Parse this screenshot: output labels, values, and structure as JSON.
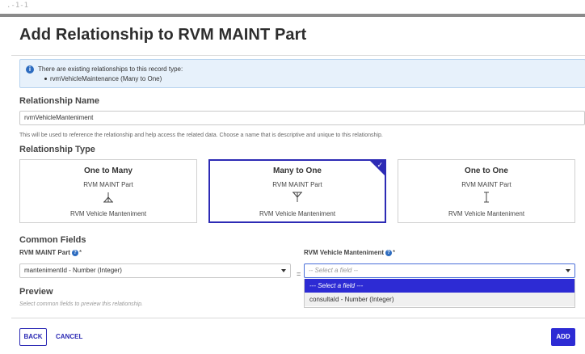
{
  "dialog": {
    "title": "Add Relationship to RVM MAINT Part"
  },
  "info": {
    "icon": "info-icon",
    "line1": "There are existing relationships to this record type:",
    "line2": "rvmVehicleMaintenance (Many to One)"
  },
  "relationship_name": {
    "label": "Relationship Name",
    "value": "rvmVehicleManteniment",
    "hint": "This will be used to reference the relationship and help access the related data. Choose a name that is descriptive and unique to this relationship."
  },
  "relationship_type": {
    "label": "Relationship Type",
    "cards": [
      {
        "title": "One to Many",
        "source": "RVM MAINT Part",
        "target": "RVM Vehicle Manteniment",
        "icon": "one-to-many-icon",
        "selected": false
      },
      {
        "title": "Many to One",
        "source": "RVM MAINT Part",
        "target": "RVM Vehicle Manteniment",
        "icon": "many-to-one-icon",
        "selected": true
      },
      {
        "title": "One to One",
        "source": "RVM MAINT Part",
        "target": "RVM Vehicle Manteniment",
        "icon": "one-to-one-icon",
        "selected": false
      }
    ]
  },
  "common_fields": {
    "label": "Common Fields",
    "left_label": "RVM MAINT Part",
    "left_value": "mantenimentId - Number (Integer)",
    "equals": "=",
    "right_label": "RVM Vehicle Manteniment",
    "right_placeholder": "-- Select a field --",
    "required_mark": "*",
    "dropdown_options": [
      "--- Select a field ---",
      "consultaId - Number (Integer)"
    ]
  },
  "preview": {
    "label": "Preview",
    "hint": "Select common fields to preview this relationship."
  },
  "footer": {
    "back": "BACK",
    "cancel": "CANCEL",
    "add": "ADD"
  },
  "colors": {
    "accent": "#2d2bd4",
    "info_bg": "#e7f1fb",
    "info_icon": "#2d6cc0"
  }
}
